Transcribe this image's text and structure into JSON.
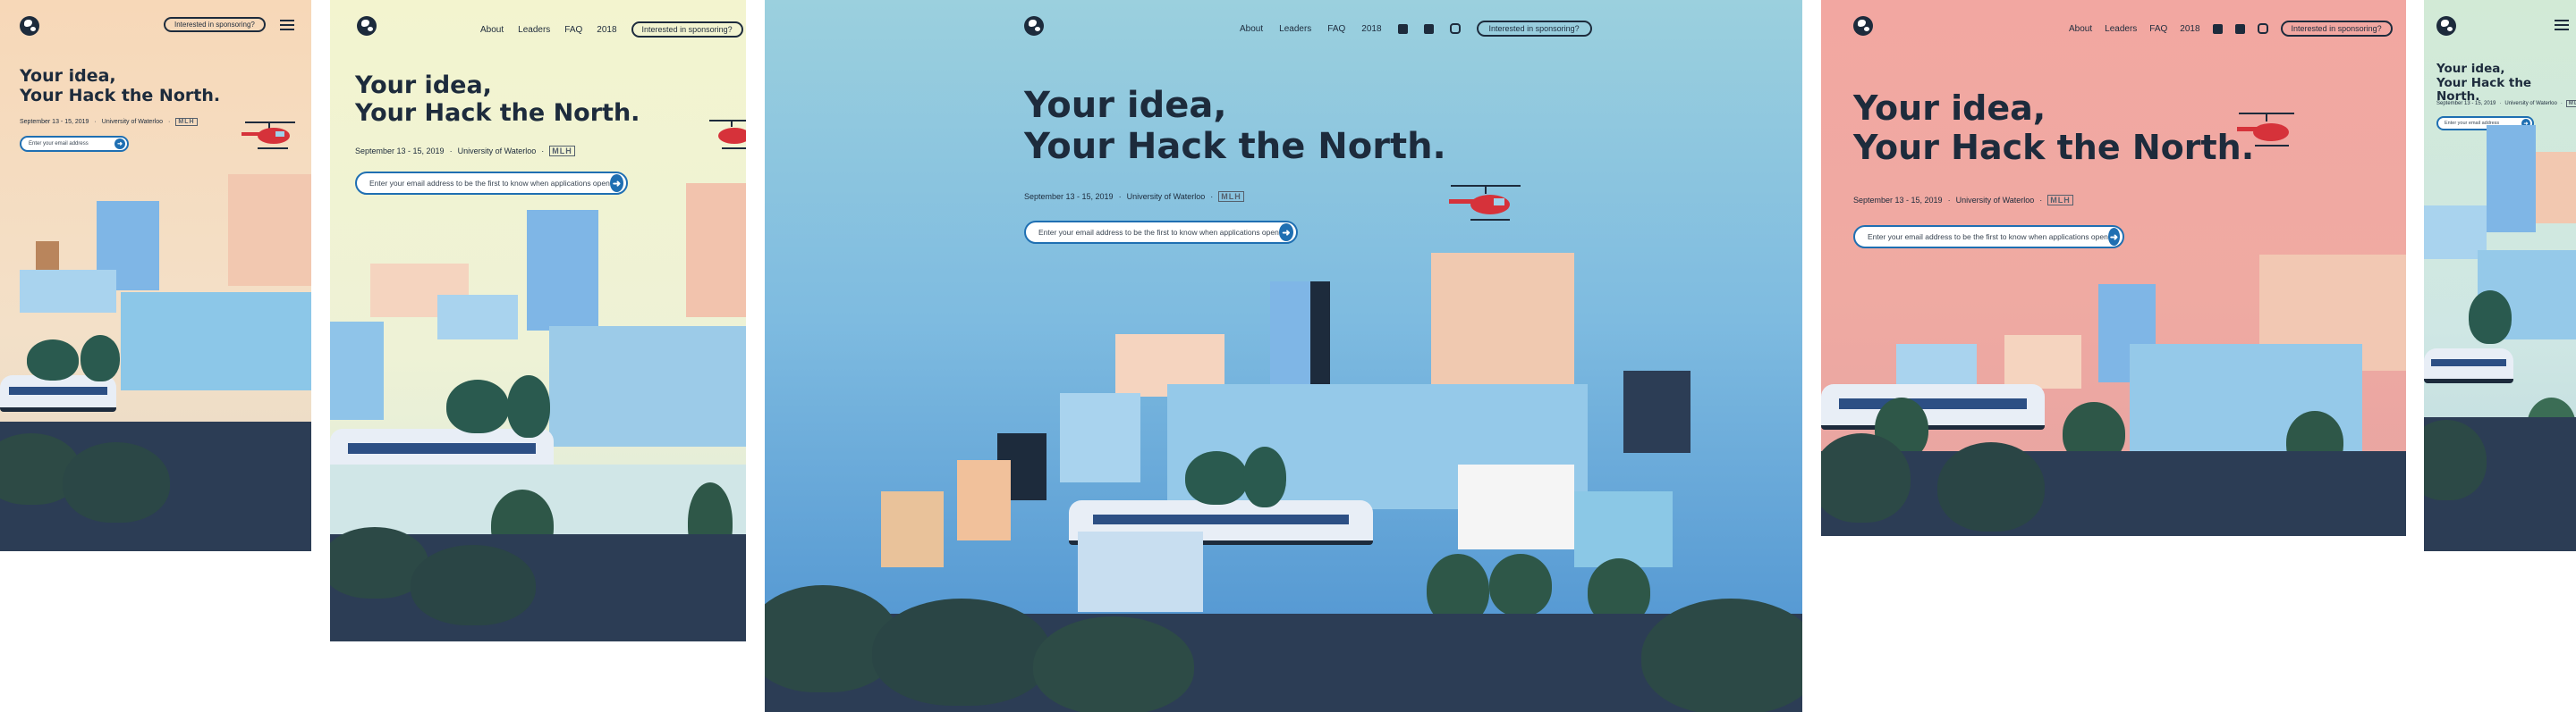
{
  "site": {
    "headline_line1": "Your idea,",
    "headline_line2": "Your Hack the North.",
    "date": "September 13 - 15, 2019",
    "location": "University of Waterloo",
    "sponsor_mark": "MLH",
    "sponsor_button": "Interested in sponsoring?",
    "email_placeholder_full": "Enter your email address to be the first to know when applications open",
    "email_placeholder_short": "Enter your email address",
    "nav": [
      "About",
      "Leaders",
      "FAQ",
      "2018"
    ],
    "submit_glyph": "➜"
  },
  "colors": {
    "panel1_bg": "#f4d4b6",
    "panel2_bg": "#eef4cf",
    "panel3_bg": "#6fb3db",
    "panel4_bg": "#f0a6a0",
    "panel5_bg": "#cfe7e4",
    "ink": "#1d2b3c",
    "accent": "#1f6fb2",
    "helicopter": "#d6323a"
  },
  "icons": [
    "globe-logo-icon",
    "facebook-icon",
    "twitter-icon",
    "instagram-icon",
    "menu-icon",
    "arrow-right-icon",
    "helicopter-icon"
  ]
}
